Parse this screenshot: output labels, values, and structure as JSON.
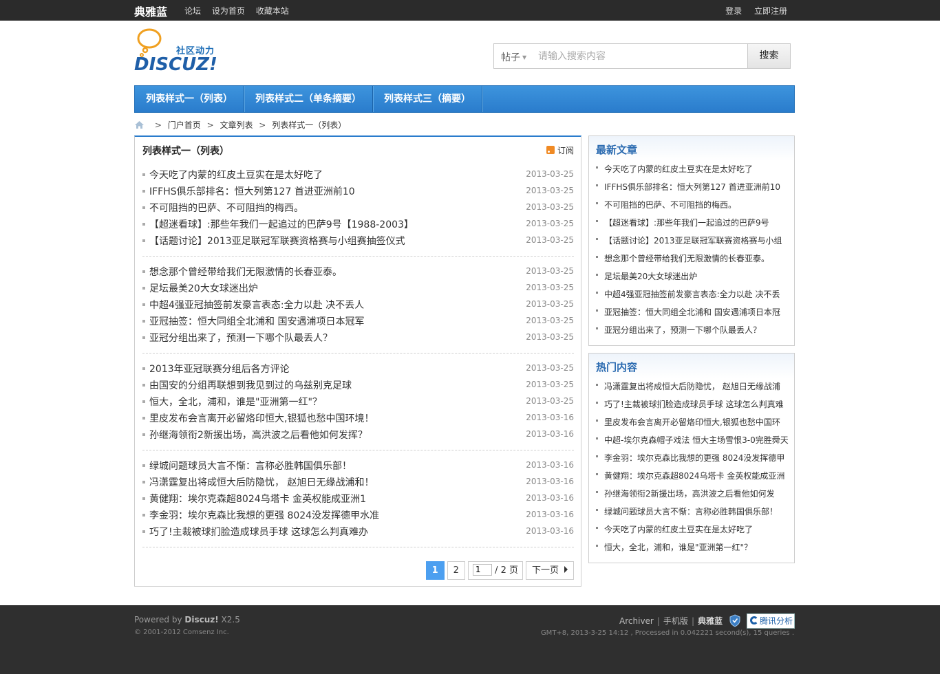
{
  "topbar": {
    "site_name": "典雅蓝",
    "links": [
      "论坛",
      "设为首页",
      "收藏本站"
    ],
    "login": "登录",
    "register": "立即注册"
  },
  "logo": {
    "slogan": "社区动力",
    "mark": "DISCUZ!"
  },
  "search": {
    "type": "帖子",
    "placeholder": "请输入搜索内容",
    "button": "搜索"
  },
  "nav": {
    "items": [
      "列表样式一（列表）",
      "列表样式二（单条摘要）",
      "列表样式三（摘要）"
    ]
  },
  "breadcrumb": {
    "items": [
      "门户首页",
      "文章列表",
      "列表样式一（列表）"
    ]
  },
  "main": {
    "title": "列表样式一（列表）",
    "rss": "订阅",
    "groups": [
      [
        {
          "title": "今天吃了内蒙的红皮土豆实在是太好吃了",
          "date": "2013-03-25"
        },
        {
          "title": "IFFHS俱乐部排名：恒大列第127 首进亚洲前10",
          "date": "2013-03-25"
        },
        {
          "title": "不可阻挡的巴萨、不可阻挡的梅西。",
          "date": "2013-03-25"
        },
        {
          "title": "【超迷看球】:那些年我们一起追过的巴萨9号【1988-2003】",
          "date": "2013-03-25"
        },
        {
          "title": "【话题讨论】2013亚足联冠军联赛资格赛与小组赛抽签仪式",
          "date": "2013-03-25"
        }
      ],
      [
        {
          "title": "想念那个曾经带给我们无限激情的长春亚泰。",
          "date": "2013-03-25"
        },
        {
          "title": "足坛最美20大女球迷出炉",
          "date": "2013-03-25"
        },
        {
          "title": "中超4强亚冠抽签前发豪言表态:全力以赴 决不丢人",
          "date": "2013-03-25"
        },
        {
          "title": "亚冠抽签：恒大同组全北浦和 国安遇浦项日本冠军",
          "date": "2013-03-25"
        },
        {
          "title": "亚冠分组出来了，预测一下哪个队最丢人？",
          "date": "2013-03-25"
        }
      ],
      [
        {
          "title": "2013年亚冠联赛分组后各方评论",
          "date": "2013-03-25"
        },
        {
          "title": "由国安的分组再联想到我见到过的乌兹别克足球",
          "date": "2013-03-25"
        },
        {
          "title": "恒大，全北，浦和，谁是\"亚洲第一红\"？",
          "date": "2013-03-25"
        },
        {
          "title": "里皮发布会言离开必留烙印恒大,银狐也愁中国环境！",
          "date": "2013-03-16"
        },
        {
          "title": "孙继海领衔2新援出场，高洪波之后看他如何发挥？",
          "date": "2013-03-16"
        }
      ],
      [
        {
          "title": "绿城问题球员大言不惭：言称必胜韩国俱乐部！",
          "date": "2013-03-16"
        },
        {
          "title": "冯潇霆复出将成恒大后防隐忧， 赵旭日无缘战浦和！",
          "date": "2013-03-16"
        },
        {
          "title": "黄健翔：埃尔克森超8024乌塔卡 金英权能成亚洲1",
          "date": "2013-03-16"
        },
        {
          "title": "李金羽：埃尔克森比我想的更强 8024没发挥德甲水准",
          "date": "2013-03-16"
        },
        {
          "title": "巧了!主裁被球扪脸造成球员手球 这球怎么判真难办",
          "date": "2013-03-16"
        }
      ]
    ],
    "pager": {
      "current": "1",
      "page2": "2",
      "input_value": "1",
      "total": "/ 2 页",
      "next": "下一页"
    }
  },
  "latest": {
    "title": "最新文章",
    "items": [
      "今天吃了内蒙的红皮土豆实在是太好吃了",
      "IFFHS俱乐部排名：恒大列第127 首进亚洲前10",
      "不可阻挡的巴萨、不可阻挡的梅西。",
      "【超迷看球】:那些年我们一起追过的巴萨9号",
      "【话题讨论】2013亚足联冠军联赛资格赛与小组",
      "想念那个曾经带给我们无限激情的长春亚泰。",
      "足坛最美20大女球迷出炉",
      "中超4强亚冠抽签前发豪言表态:全力以赴 决不丢",
      "亚冠抽签：恒大同组全北浦和 国安遇浦项日本冠",
      "亚冠分组出来了，预测一下哪个队最丢人？"
    ]
  },
  "hot": {
    "title": "热门内容",
    "items": [
      "冯潇霆复出将成恒大后防隐忧， 赵旭日无缘战浦",
      "巧了!主裁被球扪脸造成球员手球 这球怎么判真难",
      "里皮发布会言离开必留烙印恒大,银狐也愁中国环",
      "中超-埃尔克森帽子戏法 恒大主场雪恨3-0完胜舜天",
      "李金羽：埃尔克森比我想的更强 8024没发挥德甲",
      "黄健翔：埃尔克森超8024乌塔卡 金英权能成亚洲",
      "孙继海领衔2新援出场，高洪波之后看他如何发",
      "绿城问题球员大言不惭：言称必胜韩国俱乐部！",
      "今天吃了内蒙的红皮土豆实在是太好吃了",
      "恒大，全北，浦和，谁是\"亚洲第一红\"？"
    ]
  },
  "footer": {
    "powered_prefix": "Powered by ",
    "powered_brand": "Discuz!",
    "powered_version": " X2.5",
    "copyright": "© 2001-2012 Comsenz Inc.",
    "archiver": "Archiver",
    "mobile": "手机版",
    "brand": "典雅蓝",
    "analytics": "腾讯分析",
    "gmt": "GMT+8, 2013-3-25 14:12 , Processed in 0.042221 second(s), 15 queries ."
  },
  "colors": {
    "accent": "#2a7ccc",
    "title_blue": "#2a6ab0",
    "pager_current": "#4c9ff0",
    "topbar": "#2b2b2b",
    "footer": "#2f2f2f"
  }
}
